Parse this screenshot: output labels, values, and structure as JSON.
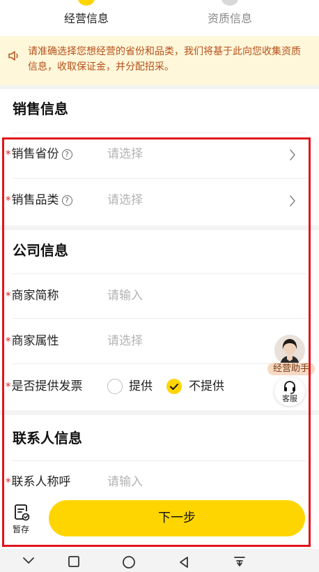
{
  "steps": [
    {
      "label": "经营信息",
      "status": "active"
    },
    {
      "label": "资质信息",
      "status": "pending"
    }
  ],
  "notice": {
    "text": "请准确选择您想经营的省份和品类，我们将基于此向您收集资质信息，收取保证金，并分配招采。",
    "icon": "speaker-icon"
  },
  "sales_section": {
    "title": "销售信息",
    "rows": [
      {
        "label": "销售省份",
        "placeholder": "请选择",
        "required": "*",
        "help": "?"
      },
      {
        "label": "销售品类",
        "placeholder": "请选择",
        "required": "*",
        "help": "?"
      }
    ]
  },
  "company_section": {
    "title": "公司信息",
    "rows": [
      {
        "label": "商家简称",
        "placeholder": "请输入",
        "required": "*"
      },
      {
        "label": "商家属性",
        "placeholder": "请选择",
        "required": "*"
      },
      {
        "label": "是否提供发票",
        "required": "*"
      }
    ],
    "invoice_options": [
      {
        "label": "提供",
        "selected": false
      },
      {
        "label": "不提供",
        "selected": true
      }
    ]
  },
  "contact_section": {
    "title": "联系人信息",
    "rows": [
      {
        "label": "联系人称呼",
        "placeholder": "请输入",
        "required": "*"
      }
    ]
  },
  "floating": {
    "assistant_label": "经营助手",
    "service_label": "客服"
  },
  "bottom": {
    "save_label": "暂存",
    "next_label": "下一步"
  },
  "colors": {
    "accent": "#ffd500",
    "required": "#e02020",
    "notice_bg": "#fff7d9",
    "notice_text": "#b5501b",
    "highlight": "#e0141c"
  }
}
